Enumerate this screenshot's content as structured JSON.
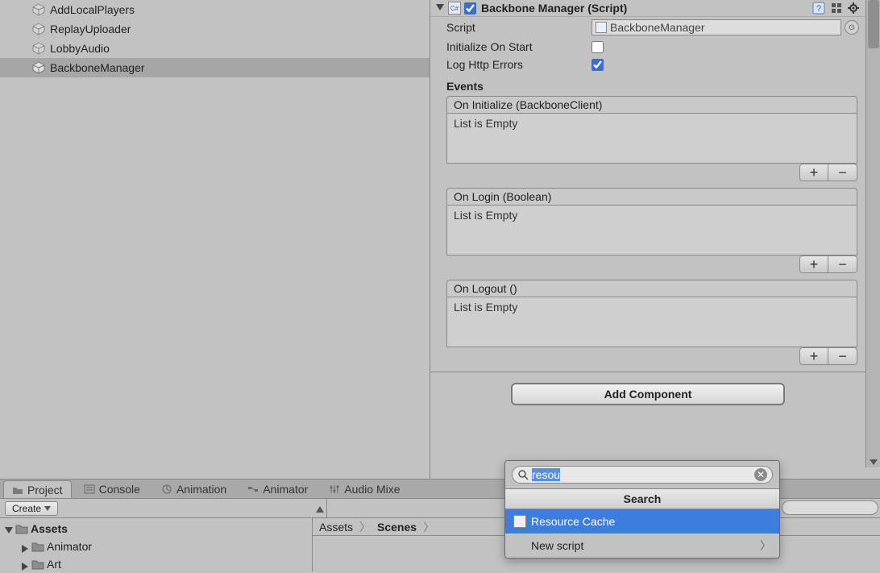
{
  "hierarchy": {
    "items": [
      {
        "name": "AddLocalPlayers",
        "selected": false
      },
      {
        "name": "ReplayUploader",
        "selected": false
      },
      {
        "name": "LobbyAudio",
        "selected": false
      },
      {
        "name": "BackboneManager",
        "selected": true
      }
    ]
  },
  "inspector": {
    "component": {
      "title": "Backbone Manager (Script)",
      "enabled": true,
      "script_label": "Script",
      "script_value": "BackboneManager",
      "init_label": "Initialize On Start",
      "init_value": false,
      "log_label": "Log Http Errors",
      "log_value": true
    },
    "events_label": "Events",
    "events": [
      {
        "header": "On Initialize (BackboneClient)",
        "body": "List is Empty"
      },
      {
        "header": "On Login (Boolean)",
        "body": "List is Empty"
      },
      {
        "header": "On Logout ()",
        "body": "List is Empty"
      }
    ],
    "add_component_label": "Add Component"
  },
  "tabs": {
    "project": "Project",
    "console": "Console",
    "animation": "Animation",
    "animator": "Animator",
    "audio": "Audio Mixe"
  },
  "toolbar": {
    "create_label": "Create"
  },
  "project_tree": {
    "root": "Assets",
    "children": [
      "Animator",
      "Art"
    ]
  },
  "breadcrumb": {
    "a": "Assets",
    "b": "Scenes"
  },
  "popup": {
    "search_value": "resou",
    "title": "Search",
    "rows": [
      {
        "label": "Resource Cache",
        "selected": true,
        "has_icon": true,
        "chev": false
      },
      {
        "label": "New script",
        "selected": false,
        "has_icon": false,
        "chev": true
      }
    ]
  }
}
